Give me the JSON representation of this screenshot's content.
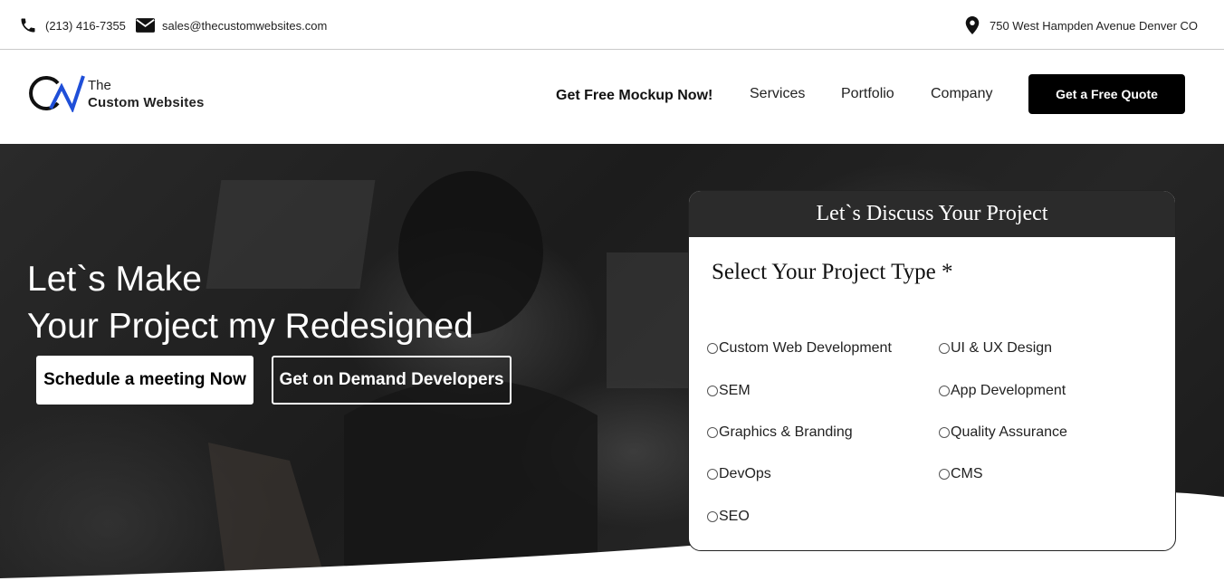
{
  "topbar": {
    "phone": "(213) 416-7355",
    "email": "sales@thecustomwebsites.com",
    "address": "750 West Hampden Avenue Denver CO"
  },
  "header": {
    "logo_line1": "The",
    "logo_line2": "Custom Websites",
    "mockup_link": "Get Free Mockup Now!",
    "nav": {
      "services": "Services",
      "portfolio": "Portfolio",
      "company": "Company"
    },
    "quote_button": "Get a Free Quote"
  },
  "hero": {
    "title_line1": "Let`s Make",
    "title_line2": "Your Project my Redesigned",
    "schedule_button": "Schedule a meeting Now",
    "developers_button": "Get on Demand Developers"
  },
  "form": {
    "heading": "Let`s Discuss Your Project",
    "subheading": "Select Your Project Type *",
    "options": [
      "Custom Web Development",
      "UI & UX Design",
      "SEM",
      "App Development",
      "Graphics & Branding",
      "Quality Assurance",
      "DevOps",
      "CMS",
      "SEO"
    ]
  },
  "colors": {
    "topbar_bg": "#ffffff",
    "button_dark": "#000000",
    "form_header_bg": "#2b2b2b",
    "logo_blue": "#1f4fd8"
  },
  "icons": [
    "phone-icon",
    "envelope-icon",
    "map-pin-icon",
    "logo-mark-icon"
  ]
}
